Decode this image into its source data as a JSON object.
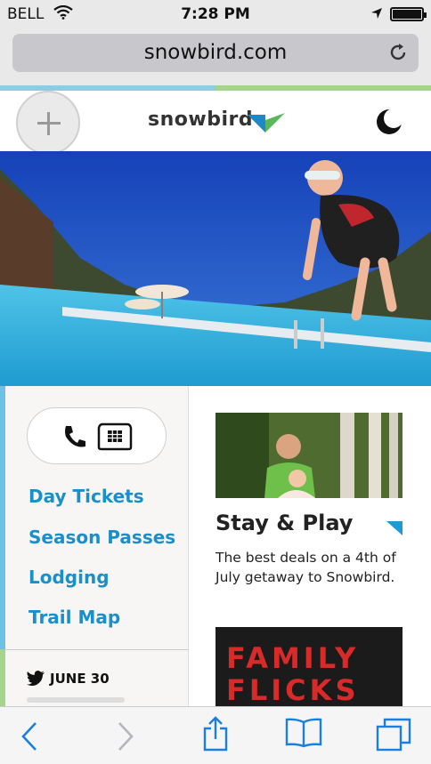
{
  "status_bar": {
    "carrier": "BELL",
    "time": "7:28 PM"
  },
  "browser": {
    "url": "snowbird.com"
  },
  "site": {
    "logo_text": "snowbird",
    "nav_links": [
      {
        "label": "Day Tickets"
      },
      {
        "label": "Season Passes"
      },
      {
        "label": "Lodging"
      },
      {
        "label": "Trail Map"
      }
    ],
    "tweet_date": "JUNE 30"
  },
  "feature": {
    "title": "Stay & Play",
    "description": "The best deals on a 4th of July getaway to Snowbird."
  },
  "feature2": {
    "line1": "FAMILY",
    "line2": "FLICKS"
  },
  "colors": {
    "accent_blue": "#1a8fc9",
    "strip_blue": "#8fcbe3",
    "strip_green": "#a6d48d"
  }
}
